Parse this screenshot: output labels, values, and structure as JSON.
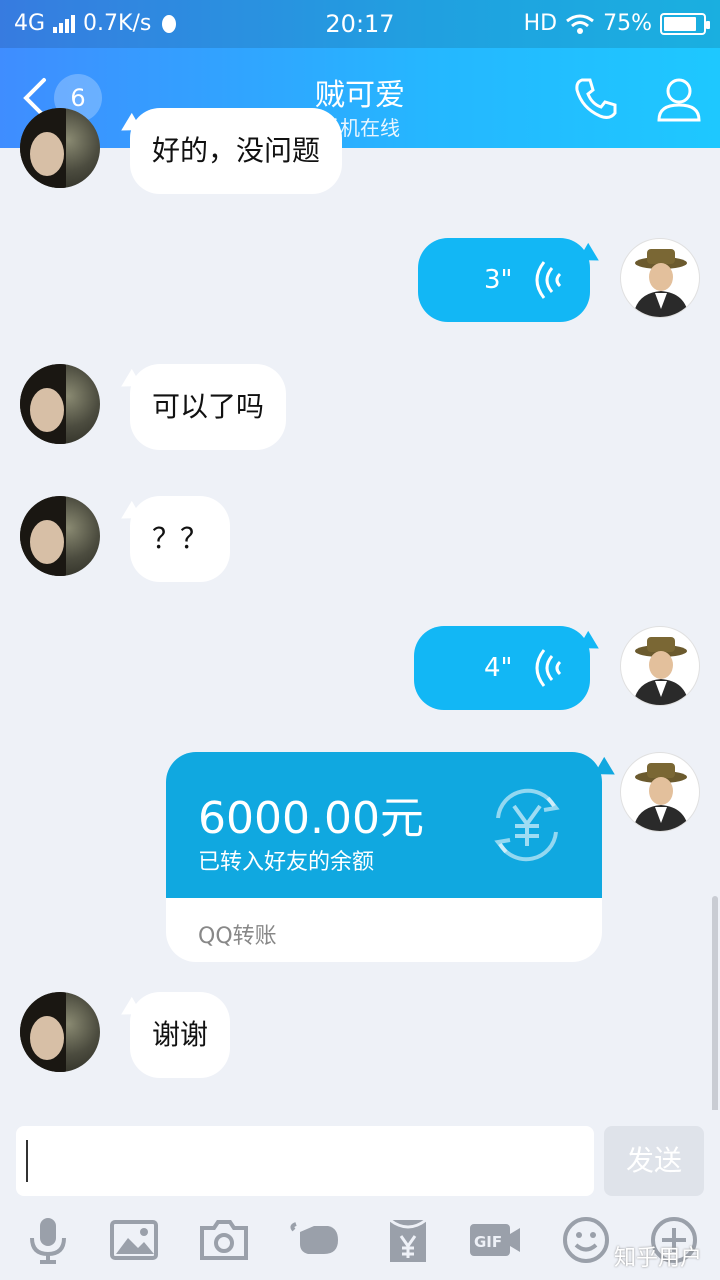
{
  "status_bar": {
    "network": "4G",
    "speed": "0.7K/s",
    "time": "20:17",
    "hd": "HD",
    "battery": "75%"
  },
  "header": {
    "unread_count": "6",
    "title": "贼可爱",
    "subtitle": "手机在线"
  },
  "messages": {
    "m1_text": "好的，没问题",
    "m2_duration": "3\"",
    "m3_text": "可以了吗",
    "m4_text": "？？",
    "m5_duration": "4\"",
    "transfer": {
      "amount": "6000.00元",
      "note": "已转入好友的余额",
      "footer": "QQ转账"
    },
    "m7_text": "谢谢"
  },
  "input": {
    "send_label": "发送"
  },
  "watermark": "知乎用户",
  "colors": {
    "accent": "#12b7f5",
    "header_start": "#3f8dff",
    "header_end": "#1ec8ff",
    "transfer_bg": "#10a8e0"
  }
}
